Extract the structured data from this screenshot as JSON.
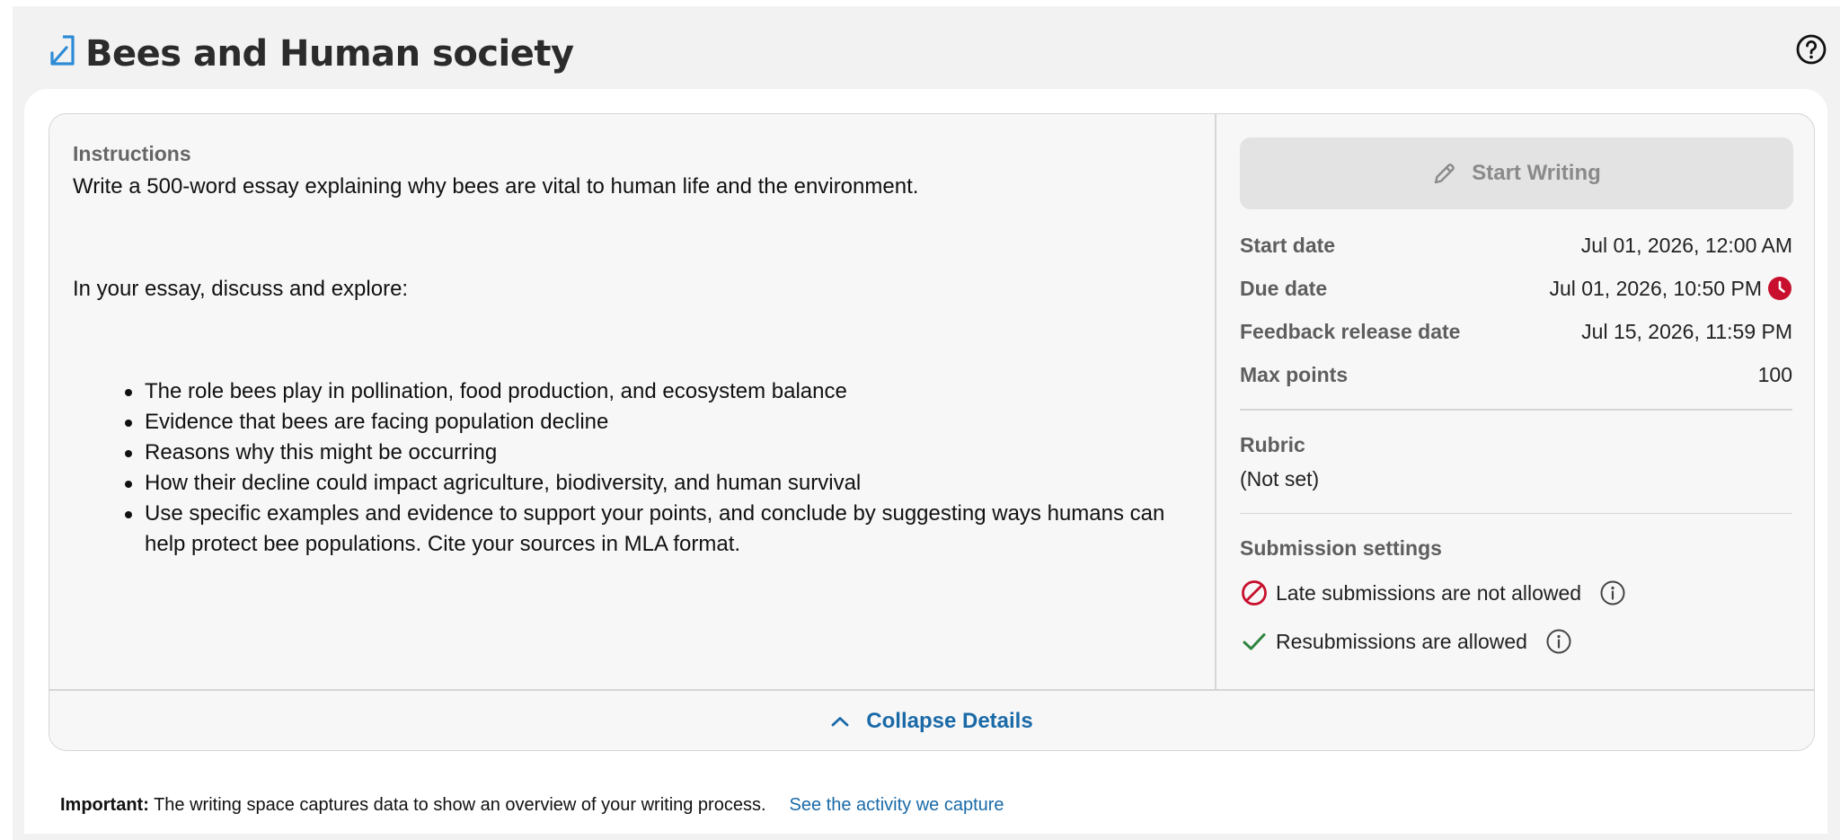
{
  "header": {
    "title": "Bees and Human society",
    "title_icon": "share-arrow-icon",
    "help_icon": "help-circle-icon"
  },
  "instructions": {
    "label": "Instructions",
    "paragraph1": "Write a 500-word essay explaining why bees are vital to human life and the environment.",
    "paragraph2": "In your essay, discuss and explore:",
    "bullets": [
      "The role bees play in pollination, food production, and ecosystem balance",
      "Evidence that bees are facing population decline",
      "Reasons why this might be occurring",
      "How their decline could impact agriculture, biodiversity, and human survival",
      "Use specific examples and evidence to support your points, and conclude by suggesting ways humans can help protect bee populations. Cite your sources in MLA format."
    ]
  },
  "side": {
    "start_label": "Start Writing",
    "meta": {
      "start_date_label": "Start date",
      "start_date_value": "Jul 01, 2026, 12:00 AM",
      "due_date_label": "Due date",
      "due_date_value": "Jul 01, 2026, 10:50 PM",
      "feedback_label": "Feedback release date",
      "feedback_value": "Jul 15, 2026, 11:59 PM",
      "max_points_label": "Max points",
      "max_points_value": "100"
    },
    "rubric_label": "Rubric",
    "rubric_value": "(Not set)",
    "submission_label": "Submission settings",
    "late_text": "Late submissions are not allowed",
    "resub_text": "Resubmissions are allowed"
  },
  "collapse_label": "Collapse Details",
  "footer": {
    "important_label": "Important:",
    "important_text": " The writing space captures data to show an overview of your writing process.",
    "link_text": "See the activity we capture"
  },
  "colors": {
    "link": "#1a6aa8",
    "title_icon": "#2d8bd6",
    "due_clock": "#c8102e",
    "not_allowed": "#c8102e",
    "check": "#2e8540"
  }
}
